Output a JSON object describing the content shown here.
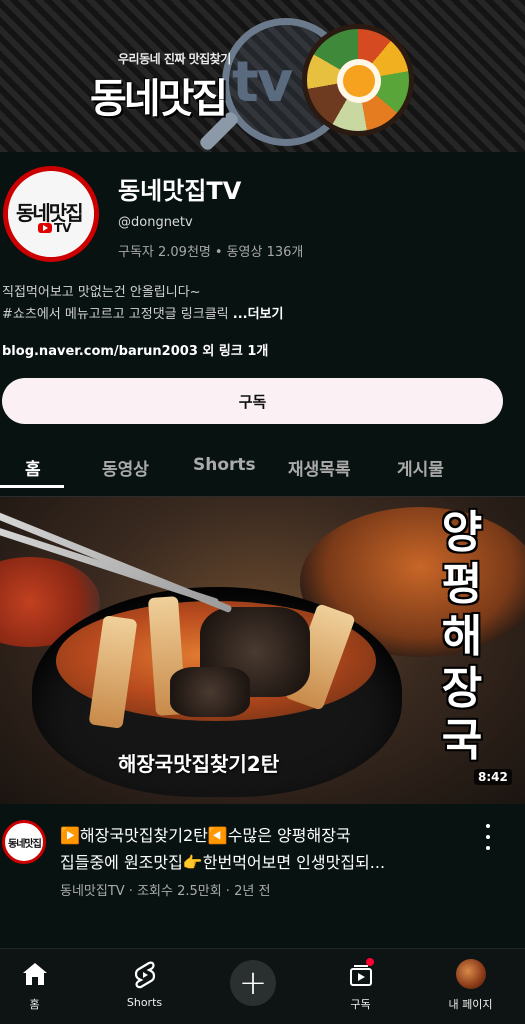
{
  "banner": {
    "tagline": "우리동네 진짜 맛집찾기",
    "title": "동네맛집",
    "tv": "tv"
  },
  "channel": {
    "avatar_text": "동네맛집",
    "avatar_tv": "TV",
    "name": "동네맛집TV",
    "handle": "@dongnetv",
    "subscribers": "구독자 2.09천명",
    "separator": "•",
    "videos": "동영상 136개",
    "description_line1": "직접먹어보고 맛없는건 안올립니다~",
    "description_line2": "#쇼츠에서 메뉴고르고 고정댓글 링크클릭 ",
    "more": "...더보기",
    "link": "blog.naver.com/barun2003 외 링크 1개",
    "subscribe_label": "구독"
  },
  "tabs": [
    {
      "label": "홈"
    },
    {
      "label": "동영상"
    },
    {
      "label": "Shorts"
    },
    {
      "label": "재생목록"
    },
    {
      "label": "게시물"
    }
  ],
  "video": {
    "thumbnail_vertical_text": "양평해장국",
    "thumbnail_caption": "해장국맛집찾기2탄",
    "duration": "8:42",
    "avatar_text": "동네맛집",
    "title_line1": "▶️해장국맛집찾기2탄◀️수많은 양평해장국",
    "title_line2": "집들중에 원조맛집👉한번먹어보면 인생맛집되...",
    "meta": "동네맛집TV · 조회수 2.5만회 · 2년 전"
  },
  "bottom_nav": [
    {
      "label": "홈",
      "icon": "home-icon"
    },
    {
      "label": "Shorts",
      "icon": "shorts-icon"
    },
    {
      "label": "",
      "icon": "create-icon",
      "glyph": "+"
    },
    {
      "label": "구독",
      "icon": "subscriptions-icon"
    },
    {
      "label": "내 페이지",
      "icon": "profile-avatar"
    }
  ],
  "colors": {
    "background": "#081311",
    "subscribe_bg": "#fbf0f3",
    "accent_red": "#cc0000",
    "notification_dot": "#ff0033"
  }
}
